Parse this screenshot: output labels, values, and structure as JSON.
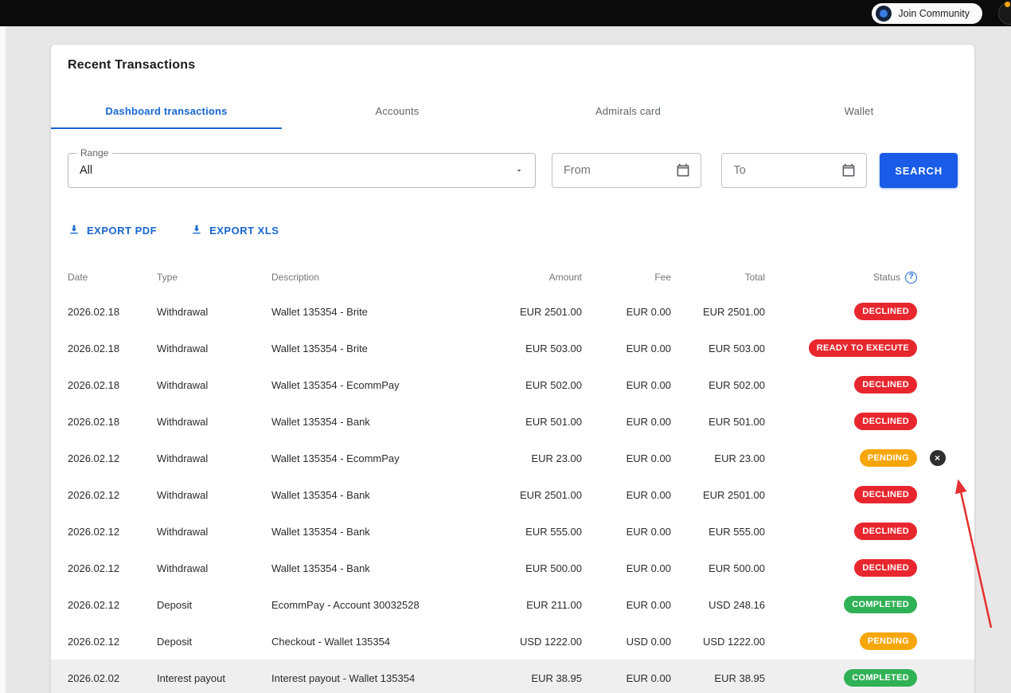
{
  "colors": {
    "topbar_bg": "#0b0b0b",
    "page_bg": "#e7e7e7",
    "blue": "#1766d2",
    "button_blue": "#1a5ce8",
    "red": "#e8262e",
    "amber": "#f7a609",
    "green": "#2fb155",
    "arrow_red": "#e53030"
  },
  "topbar": {
    "join_community_label": "Join Community"
  },
  "card": {
    "title": "Recent Transactions",
    "tabs": [
      {
        "label": "Dashboard transactions",
        "active": true
      },
      {
        "label": "Accounts",
        "active": false
      },
      {
        "label": "Admirals card",
        "active": false
      },
      {
        "label": "Wallet",
        "active": false
      }
    ],
    "filters": {
      "range_label": "Range",
      "range_value": "All",
      "from_placeholder": "From",
      "to_placeholder": "To",
      "search_label": "SEARCH"
    },
    "export": {
      "pdf_label": "EXPORT PDF",
      "xls_label": "EXPORT XLS"
    },
    "table": {
      "headers": {
        "date": "Date",
        "type": "Type",
        "description": "Description",
        "amount": "Amount",
        "fee": "Fee",
        "total": "Total",
        "status": "Status"
      },
      "rows": [
        {
          "date": "2026.02.18",
          "type": "Withdrawal",
          "description": "Wallet 135354 - Brite",
          "amount": "EUR 2501.00",
          "fee": "EUR 0.00",
          "total": "EUR 2501.00",
          "status": "DECLINED",
          "variant": "red",
          "cancelable": false,
          "highlight": false
        },
        {
          "date": "2026.02.18",
          "type": "Withdrawal",
          "description": "Wallet 135354 - Brite",
          "amount": "EUR 503.00",
          "fee": "EUR 0.00",
          "total": "EUR 503.00",
          "status": "READY TO EXECUTE",
          "variant": "red",
          "cancelable": false,
          "highlight": false
        },
        {
          "date": "2026.02.18",
          "type": "Withdrawal",
          "description": "Wallet 135354 - EcommPay",
          "amount": "EUR 502.00",
          "fee": "EUR 0.00",
          "total": "EUR 502.00",
          "status": "DECLINED",
          "variant": "red",
          "cancelable": false,
          "highlight": false
        },
        {
          "date": "2026.02.18",
          "type": "Withdrawal",
          "description": "Wallet 135354 - Bank",
          "amount": "EUR 501.00",
          "fee": "EUR 0.00",
          "total": "EUR 501.00",
          "status": "DECLINED",
          "variant": "red",
          "cancelable": false,
          "highlight": false
        },
        {
          "date": "2026.02.12",
          "type": "Withdrawal",
          "description": "Wallet 135354 - EcommPay",
          "amount": "EUR 23.00",
          "fee": "EUR 0.00",
          "total": "EUR 23.00",
          "status": "PENDING",
          "variant": "amber",
          "cancelable": true,
          "highlight": false
        },
        {
          "date": "2026.02.12",
          "type": "Withdrawal",
          "description": "Wallet 135354 - Bank",
          "amount": "EUR 2501.00",
          "fee": "EUR 0.00",
          "total": "EUR 2501.00",
          "status": "DECLINED",
          "variant": "red",
          "cancelable": false,
          "highlight": false
        },
        {
          "date": "2026.02.12",
          "type": "Withdrawal",
          "description": "Wallet 135354 - Bank",
          "amount": "EUR 555.00",
          "fee": "EUR 0.00",
          "total": "EUR 555.00",
          "status": "DECLINED",
          "variant": "red",
          "cancelable": false,
          "highlight": false
        },
        {
          "date": "2026.02.12",
          "type": "Withdrawal",
          "description": "Wallet 135354 - Bank",
          "amount": "EUR 500.00",
          "fee": "EUR 0.00",
          "total": "EUR 500.00",
          "status": "DECLINED",
          "variant": "red",
          "cancelable": false,
          "highlight": false
        },
        {
          "date": "2026.02.12",
          "type": "Deposit",
          "description": "EcommPay - Account 30032528",
          "amount": "EUR 211.00",
          "fee": "EUR 0.00",
          "total": "USD 248.16",
          "status": "COMPLETED",
          "variant": "green",
          "cancelable": false,
          "highlight": false
        },
        {
          "date": "2026.02.12",
          "type": "Deposit",
          "description": "Checkout - Wallet 135354",
          "amount": "USD 1222.00",
          "fee": "USD 0.00",
          "total": "USD 1222.00",
          "status": "PENDING",
          "variant": "amber",
          "cancelable": false,
          "highlight": false
        },
        {
          "date": "2026.02.02",
          "type": "Interest payout",
          "description": "Interest payout - Wallet 135354",
          "amount": "EUR 38.95",
          "fee": "EUR 0.00",
          "total": "EUR 38.95",
          "status": "COMPLETED",
          "variant": "green",
          "cancelable": false,
          "highlight": true
        }
      ]
    }
  }
}
